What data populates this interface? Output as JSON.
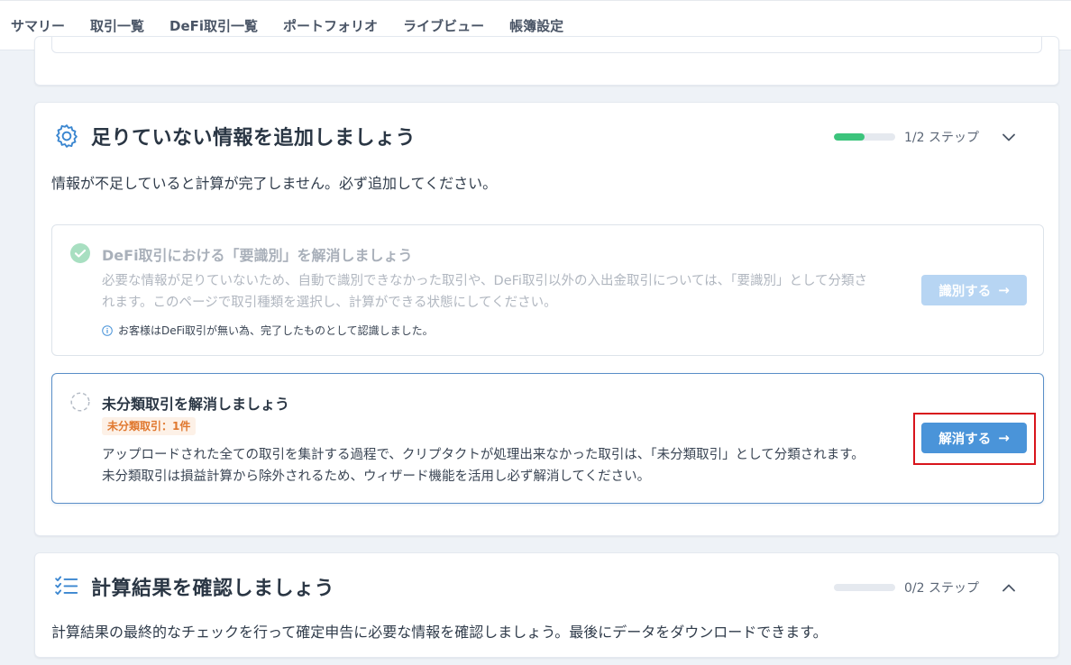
{
  "nav": {
    "items": [
      {
        "label": "サマリー"
      },
      {
        "label": "取引一覧"
      },
      {
        "label": "DeFi取引一覧"
      },
      {
        "label": "ポートフォリオ"
      },
      {
        "label": "ライブビュー"
      },
      {
        "label": "帳簿設定"
      }
    ]
  },
  "missing_info": {
    "icon": "gear-icon",
    "title": "足りていない情報を追加しましょう",
    "progress_value": 0.5,
    "progress_text": "1/2 ステップ",
    "description": "情報が不足していると計算が完了しません。必ず追加してください。",
    "defi_task": {
      "title": "DeFi取引における「要識別」を解消しましょう",
      "body": "必要な情報が足りていないため、自動で識別できなかった取引や、DeFi取引以外の入出金取引については、「要識別」として分類されます。このページで取引種類を選択し、計算ができる状態にしてください。",
      "note": "お客様はDeFi取引が無い為、完了したものとして認識しました。",
      "button_label": "識別する",
      "status": "completed"
    },
    "unclassified_task": {
      "title": "未分類取引を解消しましょう",
      "badge": "未分類取引：1件",
      "body": "アップロードされた全ての取引を集計する過程で、クリプタクトが処理出来なかった取引は、「未分類取引」として分類されます。未分類取引は損益計算から除外されるため、ウィザード機能を活用し必ず解消してください。",
      "button_label": "解消する",
      "status": "pending"
    }
  },
  "result_check": {
    "icon": "checklist-icon",
    "title": "計算結果を確認しましょう",
    "progress_value": 0,
    "progress_text": "0/2 ステップ",
    "description": "計算結果の最終的なチェックを行って確定申告に必要な情報を確認しましょう。最後にデータをダウンロードできます。"
  },
  "colors": {
    "accent": "#4a94d9",
    "success": "#3cc47c",
    "warning": "#e0782f",
    "highlight": "#d8141c"
  }
}
